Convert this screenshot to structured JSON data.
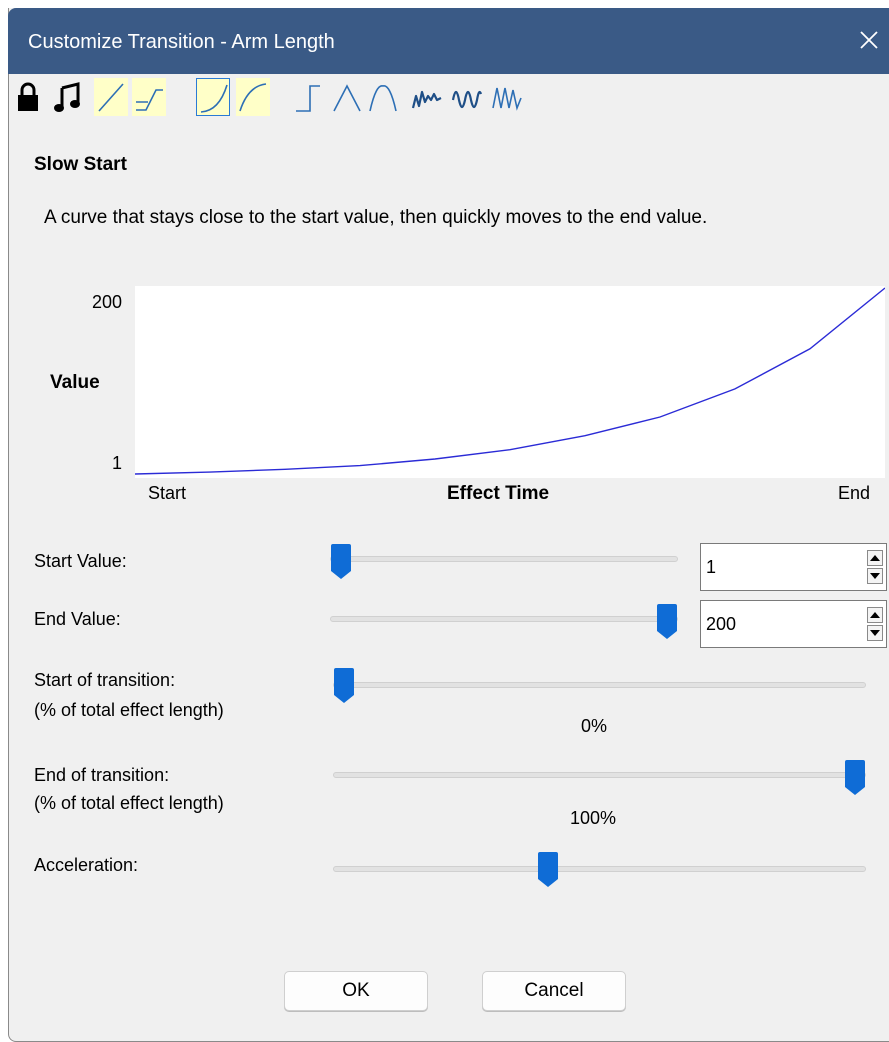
{
  "window": {
    "title": "Customize Transition - Arm Length"
  },
  "toolbar": {
    "tools": [
      {
        "icon": "lock-icon"
      },
      {
        "icon": "music-note-icon"
      },
      {
        "icon": "linear-curve-icon"
      },
      {
        "icon": "step-linear-curve-icon"
      },
      {
        "icon": "slow-start-curve-icon",
        "selected": true
      },
      {
        "icon": "slow-end-curve-icon"
      },
      {
        "icon": "step-curve-icon"
      },
      {
        "icon": "peak-curve-icon"
      },
      {
        "icon": "round-peak-curve-icon"
      },
      {
        "icon": "random-wave-icon"
      },
      {
        "icon": "sine-wave-icon"
      },
      {
        "icon": "zigzag-wave-icon"
      }
    ]
  },
  "curve": {
    "name": "Slow Start",
    "description": "A curve that stays close to the start value, then quickly moves to the end value."
  },
  "graph": {
    "y_max_label": "200",
    "y_min_label": "1",
    "y_axis_label": "Value",
    "x_start_label": "Start",
    "x_axis_label": "Effect Time",
    "x_end_label": "End",
    "line_color": "#2b2bd6"
  },
  "chart_data": {
    "type": "line",
    "xlabel": "Effect Time",
    "ylabel": "Value",
    "ylim": [
      1,
      200
    ],
    "x_ticks": [
      "Start",
      "End"
    ],
    "y_ticks": [
      "1",
      "200"
    ],
    "series": [
      {
        "x": [
          0,
          0.1,
          0.2,
          0.3,
          0.4,
          0.5,
          0.6,
          0.7,
          0.8,
          0.9,
          1.0
        ],
        "y": [
          1,
          3,
          6,
          10,
          17,
          27,
          42,
          62,
          92,
          135,
          200
        ]
      }
    ]
  },
  "fields": {
    "start_value": {
      "label": "Start Value:",
      "value": "1",
      "slider_fraction": 0.0
    },
    "end_value": {
      "label": "End Value:",
      "value": "200",
      "slider_fraction": 1.0
    },
    "start_transition": {
      "label1": "Start of transition:",
      "label2": "(% of total effect length)",
      "display": "0%",
      "slider_fraction": 0.0
    },
    "end_transition": {
      "label1": "End of transition:",
      "label2": "(% of total effect length)",
      "display": "100%",
      "slider_fraction": 1.0
    },
    "acceleration": {
      "label": "Acceleration:",
      "slider_fraction": 0.4
    }
  },
  "buttons": {
    "ok": "OK",
    "cancel": "Cancel"
  },
  "colors": {
    "title_bar": "#3a5a86",
    "accent": "#0f6cd6",
    "curve_bg": "#ffffc8"
  }
}
